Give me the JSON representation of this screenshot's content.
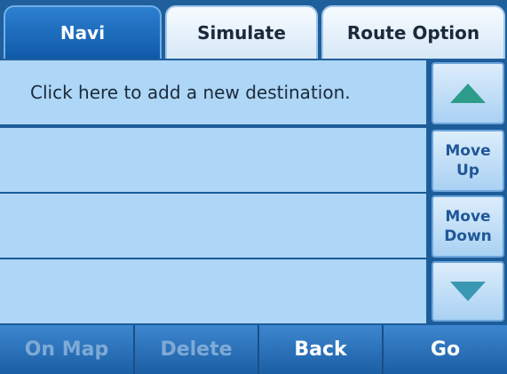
{
  "tabs": [
    {
      "label": "Navi",
      "active": true
    },
    {
      "label": "Simulate",
      "active": false
    },
    {
      "label": "Route Option",
      "active": false
    }
  ],
  "list": {
    "rows": [
      "Click here to add a new destination.",
      "",
      "",
      ""
    ]
  },
  "side": {
    "move_up_line1": "Move",
    "move_up_line2": "Up",
    "move_down_line1": "Move",
    "move_down_line2": "Down",
    "up_icon": "triangle-up-icon",
    "down_icon": "triangle-down-icon"
  },
  "bottom": {
    "on_map": "On Map",
    "delete": "Delete",
    "back": "Back",
    "go": "Go"
  },
  "colors": {
    "accent": "#0f5aa8",
    "list_bg": "#aed6f6",
    "disabled_text": "#7faad6"
  }
}
